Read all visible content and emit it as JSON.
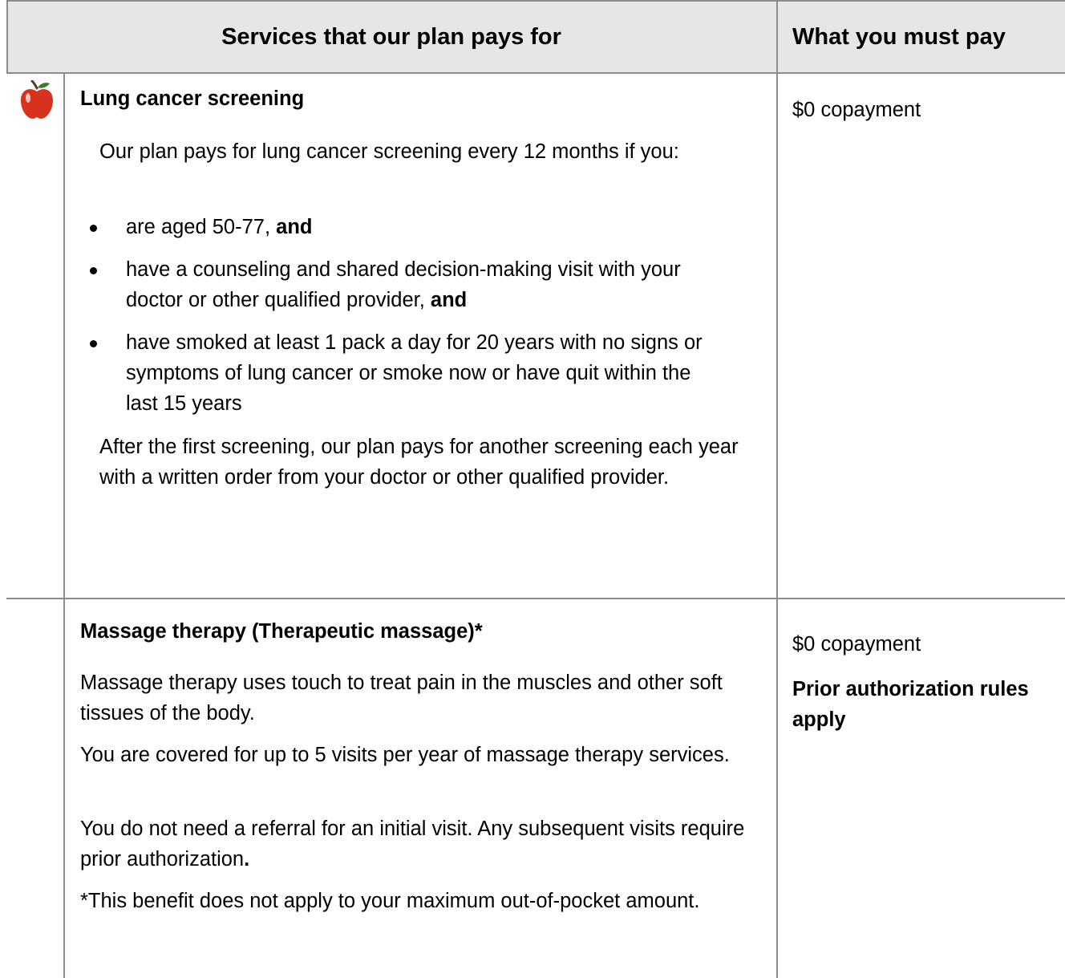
{
  "header": {
    "services_col": "Services that our plan pays for",
    "pay_col": "What you must pay"
  },
  "rows": [
    {
      "title": "Lung cancer screening",
      "intro": "Our plan pays for lung cancer screening every 12 months if you:",
      "bullets": [
        {
          "text": "are aged 50-77,",
          "suffix": "and"
        },
        {
          "text": "have a counseling and shared decision-making visit with your doctor or other qualified provider,",
          "suffix": "and"
        },
        {
          "text": "have smoked at least 1 pack a day for 20 years with no signs or symptoms of lung cancer or smoke now or have quit within the last 15 years",
          "suffix": ""
        }
      ],
      "after": "After the first screening, our plan pays for another screening each year with a written order from your doctor or other qualified provider.",
      "pay": "$0 copayment",
      "icon": "apple-icon"
    },
    {
      "title": "Massage therapy (Therapeutic massage)*",
      "paragraphs": [
        "Massage therapy uses touch to treat pain in the muscles and other soft tissues of the body.",
        "You are covered for up to 5 visits per year of massage therapy services.",
        "You do not need a referral for an initial visit. Any subsequent visits require prior authorization",
        "*This benefit does not apply to your maximum out-of-pocket amount."
      ],
      "period": ".",
      "pay": "$0 copayment",
      "pay_note": "Prior authorization rules apply"
    }
  ],
  "colors": {
    "header_bg": "#e6e6e6",
    "border": "#8c8c8c",
    "apple_red": "#d8321e"
  }
}
